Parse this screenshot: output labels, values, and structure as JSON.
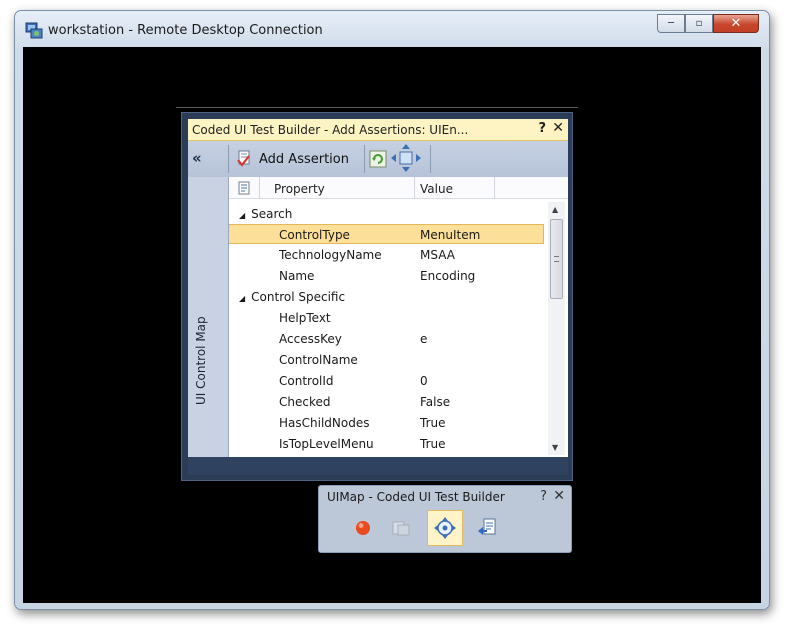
{
  "window": {
    "title": "workstation - Remote Desktop Connection",
    "minimize_label": "─",
    "maximize_label": "▫",
    "close_label": "✕"
  },
  "builder": {
    "title": "Coded UI Test Builder - Add Assertions: UIEn...",
    "help_label": "?",
    "close_label": "✕",
    "collapse_label": "«",
    "add_assertion_label": "Add Assertion",
    "side_label": "UI Control Map",
    "grid": {
      "columns": [
        "Property",
        "Value"
      ],
      "categories": [
        {
          "name": "Search",
          "expander": "◢",
          "rows": [
            {
              "property": "ControlType",
              "value": "MenuItem",
              "selected": true
            },
            {
              "property": "TechnologyName",
              "value": "MSAA"
            },
            {
              "property": "Name",
              "value": "Encoding"
            }
          ]
        },
        {
          "name": "Control Specific",
          "expander": "◢",
          "rows": [
            {
              "property": "HelpText",
              "value": ""
            },
            {
              "property": "AccessKey",
              "value": "e"
            },
            {
              "property": "ControlName",
              "value": ""
            },
            {
              "property": "ControlId",
              "value": "0"
            },
            {
              "property": "Checked",
              "value": "False"
            },
            {
              "property": "HasChildNodes",
              "value": "True"
            },
            {
              "property": "IsTopLevelMenu",
              "value": "True"
            }
          ]
        }
      ]
    },
    "scroll_up_glyph": "▲",
    "scroll_down_glyph": "▼"
  },
  "uimap": {
    "title": "UIMap - Coded UI Test Builder",
    "help_label": "?",
    "close_label": "✕",
    "buttons": [
      "record-icon",
      "recorded-steps-icon",
      "crosshair-icon",
      "generate-code-icon"
    ]
  },
  "colors": {
    "selected_row": "#fcdf98",
    "title_highlight": "#fdf3c3",
    "panel_bg": "#2b3c57"
  }
}
